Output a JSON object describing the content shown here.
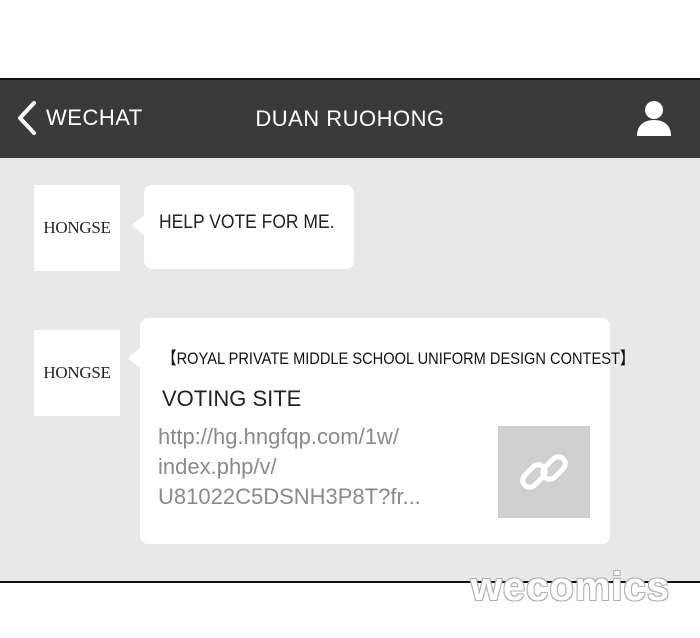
{
  "header": {
    "back_label": "WECHAT",
    "title": "DUAN RUOHONG",
    "icons": {
      "back": "chevron-left-icon",
      "profile": "person-icon"
    }
  },
  "messages": [
    {
      "sender_avatar": "HONGSE",
      "text": "HELP VOTE FOR ME."
    },
    {
      "sender_avatar": "HONGSE",
      "link_card": {
        "title": "【ROYAL PRIVATE MIDDLE SCHOOL UNIFORM DESIGN CONTEST】",
        "subtitle": "VOTING SITE",
        "url_lines": [
          "http://hg.hngfqp.com/1w/",
          "index.php/v/",
          "U81022C5DSNH3P8T?fr..."
        ],
        "thumbnail_icon": "link-icon"
      }
    }
  ],
  "watermark": "wecomics",
  "colors": {
    "topbar": "#3a3a3a",
    "chat_background": "#e8e8e8",
    "bubble": "#ffffff",
    "url_text": "#8a8a8a",
    "thumbnail": "#cfcfcf"
  }
}
